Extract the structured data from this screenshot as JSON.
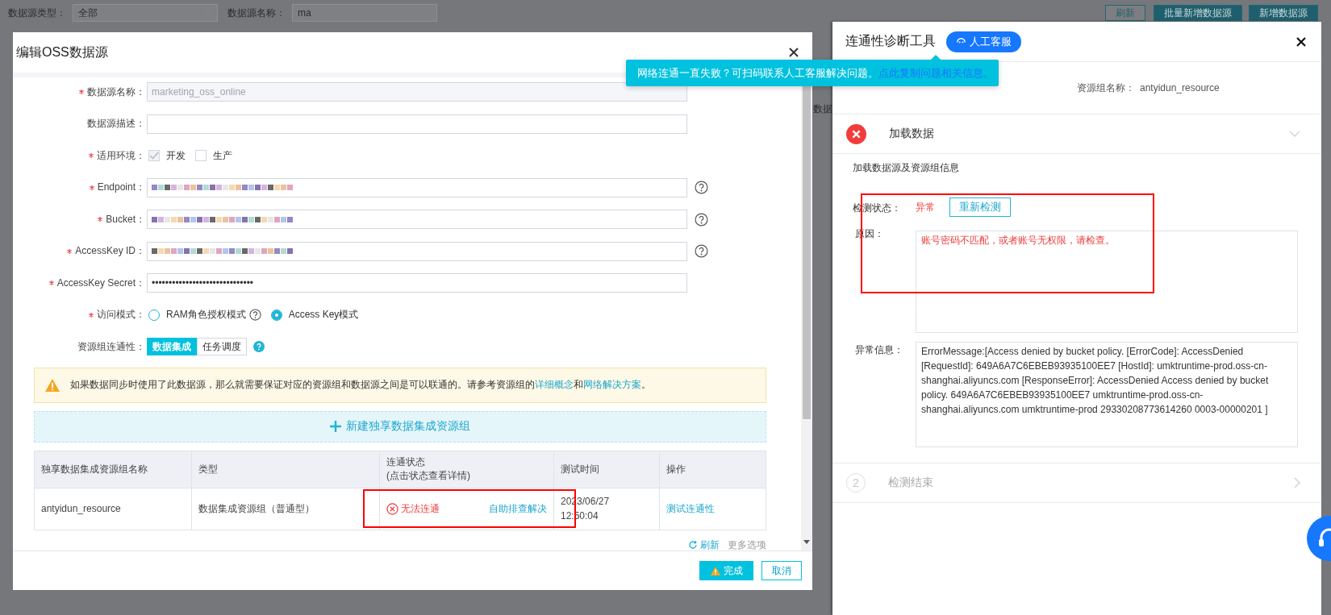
{
  "background": {
    "filters": [
      {
        "label": "数据源类型：",
        "value": "全部",
        "kind": "select"
      },
      {
        "label": "数据源名称：",
        "value": "ma",
        "kind": "input"
      }
    ],
    "buttons": [
      "刷新",
      "批量新增数据源",
      "新增数据源"
    ],
    "column_fragment": "数据"
  },
  "modal": {
    "title": "编辑OSS数据源",
    "fields": [
      {
        "label": "数据源名称：",
        "required": true,
        "kind": "input",
        "value": "marketing_oss_online",
        "disabled": true
      },
      {
        "label": "数据源描述：",
        "kind": "input"
      },
      {
        "label": "适用环境：",
        "required": true,
        "kind": "checkboxes",
        "options": [
          {
            "label": "开发",
            "checked": true,
            "disabled": true
          },
          {
            "label": "生产",
            "checked": false
          }
        ]
      },
      {
        "label": "Endpoint：",
        "required": true,
        "kind": "input",
        "redacted": true,
        "help": true
      },
      {
        "label": "Bucket：",
        "required": true,
        "kind": "input",
        "redacted": true,
        "help": true
      },
      {
        "label": "AccessKey ID：",
        "required": true,
        "kind": "input",
        "redacted": true,
        "help": true
      },
      {
        "label": "AccessKey Secret：",
        "required": true,
        "kind": "input",
        "value": "••••••••••••••••••••••••••••••"
      },
      {
        "label": "访问模式：",
        "required": true,
        "kind": "radios",
        "options": [
          {
            "label": "RAM角色授权模式",
            "selected": false,
            "help": true
          },
          {
            "label": "Access Key模式",
            "selected": true
          }
        ]
      },
      {
        "label": "资源组连通性：",
        "kind": "segmented",
        "help": true,
        "options": [
          {
            "label": "数据集成",
            "selected": true
          },
          {
            "label": "任务调度",
            "selected": false
          }
        ]
      }
    ],
    "notice": [
      {
        "text": "如果数据同步时使用了此数据源，那么就需要保证对应的资源组和数据源之间是可以联通的。请参考资源组的"
      },
      {
        "text": "详细概念",
        "link": true
      },
      {
        "text": "和"
      },
      {
        "text": "网络解决方案",
        "link": true
      },
      {
        "text": "。"
      }
    ],
    "add_group_button": "新建独享数据集成资源组",
    "table": {
      "columns": [
        {
          "label": "独享数据集成资源组名称"
        },
        {
          "label": "类型"
        },
        {
          "label": "连通状态",
          "sublabel": "(点击状态查看详情)"
        },
        {
          "label": "测试时间"
        },
        {
          "label": "操作"
        }
      ],
      "rows": [
        {
          "name": "antyidun_resource",
          "type": "数据集成资源组（普通型）",
          "status": "无法连通",
          "status_ok": false,
          "fix_link": "自助排查解决",
          "test_time": "2023/06/27 12:50:04",
          "action": "测试连通性"
        }
      ]
    },
    "table_footer": {
      "refresh": "刷新",
      "more": "更多选项"
    },
    "footer_buttons": [
      {
        "label": "完成",
        "kind": "primary"
      },
      {
        "label": "取消",
        "kind": "secondary"
      }
    ]
  },
  "panel": {
    "title": "连通性诊断工具",
    "support_button": "人工客服",
    "info": {
      "label": "资源组名称：",
      "value": "antyidun_resource"
    },
    "steps": [
      {
        "title": "加载数据",
        "failed": true,
        "expanded": true,
        "description": "加载数据源及资源组信息",
        "check_label": "检测状态：",
        "check_value": "异常",
        "recheck_button": "重新检测",
        "reason_label": "原因：",
        "reason": "账号密码不匹配，或者账号无权限，请检查。",
        "error_label": "异常信息：",
        "error": "ErrorMessage:[Access denied by bucket policy. [ErrorCode]: AccessDenied [RequestId]: 649A6A7C6EBEB93935100EE7 [HostId]: umktruntime-prod.oss-cn-shanghai.aliyuncs.com [ResponseError]: AccessDenied Access denied by bucket policy. 649A6A7C6EBEB93935100EE7 umktruntime-prod.oss-cn-shanghai.aliyuncs.com umktruntime-prod 29330208773614260 0003-00000201 ]"
      },
      {
        "number": "2",
        "title": "检测结束",
        "failed": false,
        "expanded": false
      }
    ]
  },
  "tooltip": {
    "text": "网络连通一直失败？可扫码联系人工客服解决问题。",
    "link": "点此复制问题相关信息。"
  },
  "annotations": [
    {
      "kind": "box"
    },
    {
      "kind": "box"
    }
  ]
}
